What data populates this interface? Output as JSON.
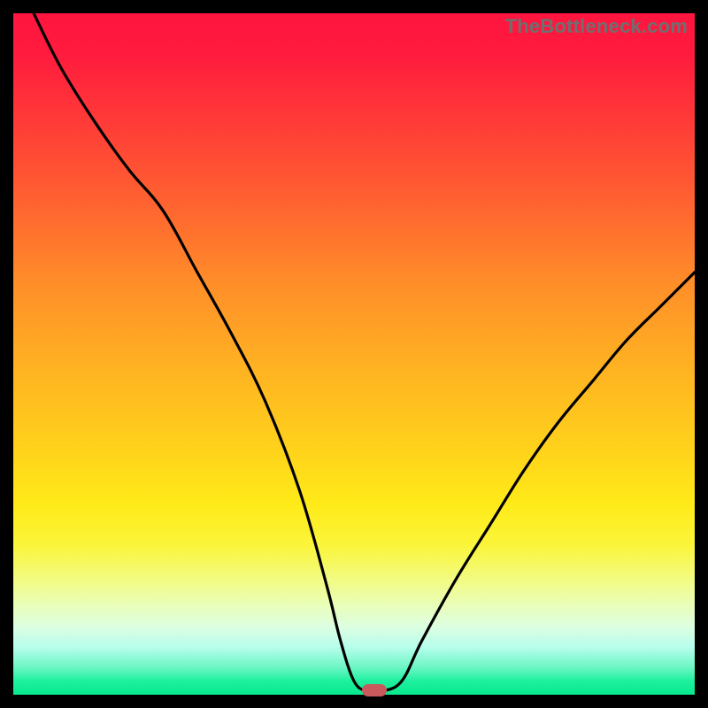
{
  "watermark": "TheBottleneck.com",
  "colors": {
    "curve_stroke": "#000000",
    "marker_fill": "#c85a5d",
    "frame": "#000000"
  },
  "chart_data": {
    "type": "line",
    "title": "",
    "xlabel": "",
    "ylabel": "",
    "xlim": [
      0,
      100
    ],
    "ylim": [
      0,
      100
    ],
    "grid": false,
    "legend": false,
    "series": [
      {
        "name": "bottleneck-curve",
        "x": [
          3,
          7,
          12,
          17,
          22,
          27,
          32,
          37,
          42,
          46,
          48,
          50,
          52,
          54,
          57,
          60,
          65,
          70,
          75,
          80,
          85,
          90,
          95,
          100
        ],
        "y": [
          100,
          92,
          84,
          77,
          71,
          62,
          53,
          43,
          30,
          16,
          8,
          2,
          0.5,
          0.5,
          2,
          8,
          17,
          25,
          33,
          40,
          46,
          52,
          57,
          62
        ]
      }
    ],
    "annotations": [
      {
        "name": "optimal-marker",
        "x": 53,
        "y": 0.6,
        "shape": "rounded-rect"
      }
    ],
    "background_gradient": {
      "direction": "top-to-bottom",
      "stops": [
        {
          "pos": 0,
          "color": "#ff153f"
        },
        {
          "pos": 50,
          "color": "#ffb222"
        },
        {
          "pos": 78,
          "color": "#fbf53a"
        },
        {
          "pos": 100,
          "color": "#07e98d"
        }
      ]
    }
  }
}
